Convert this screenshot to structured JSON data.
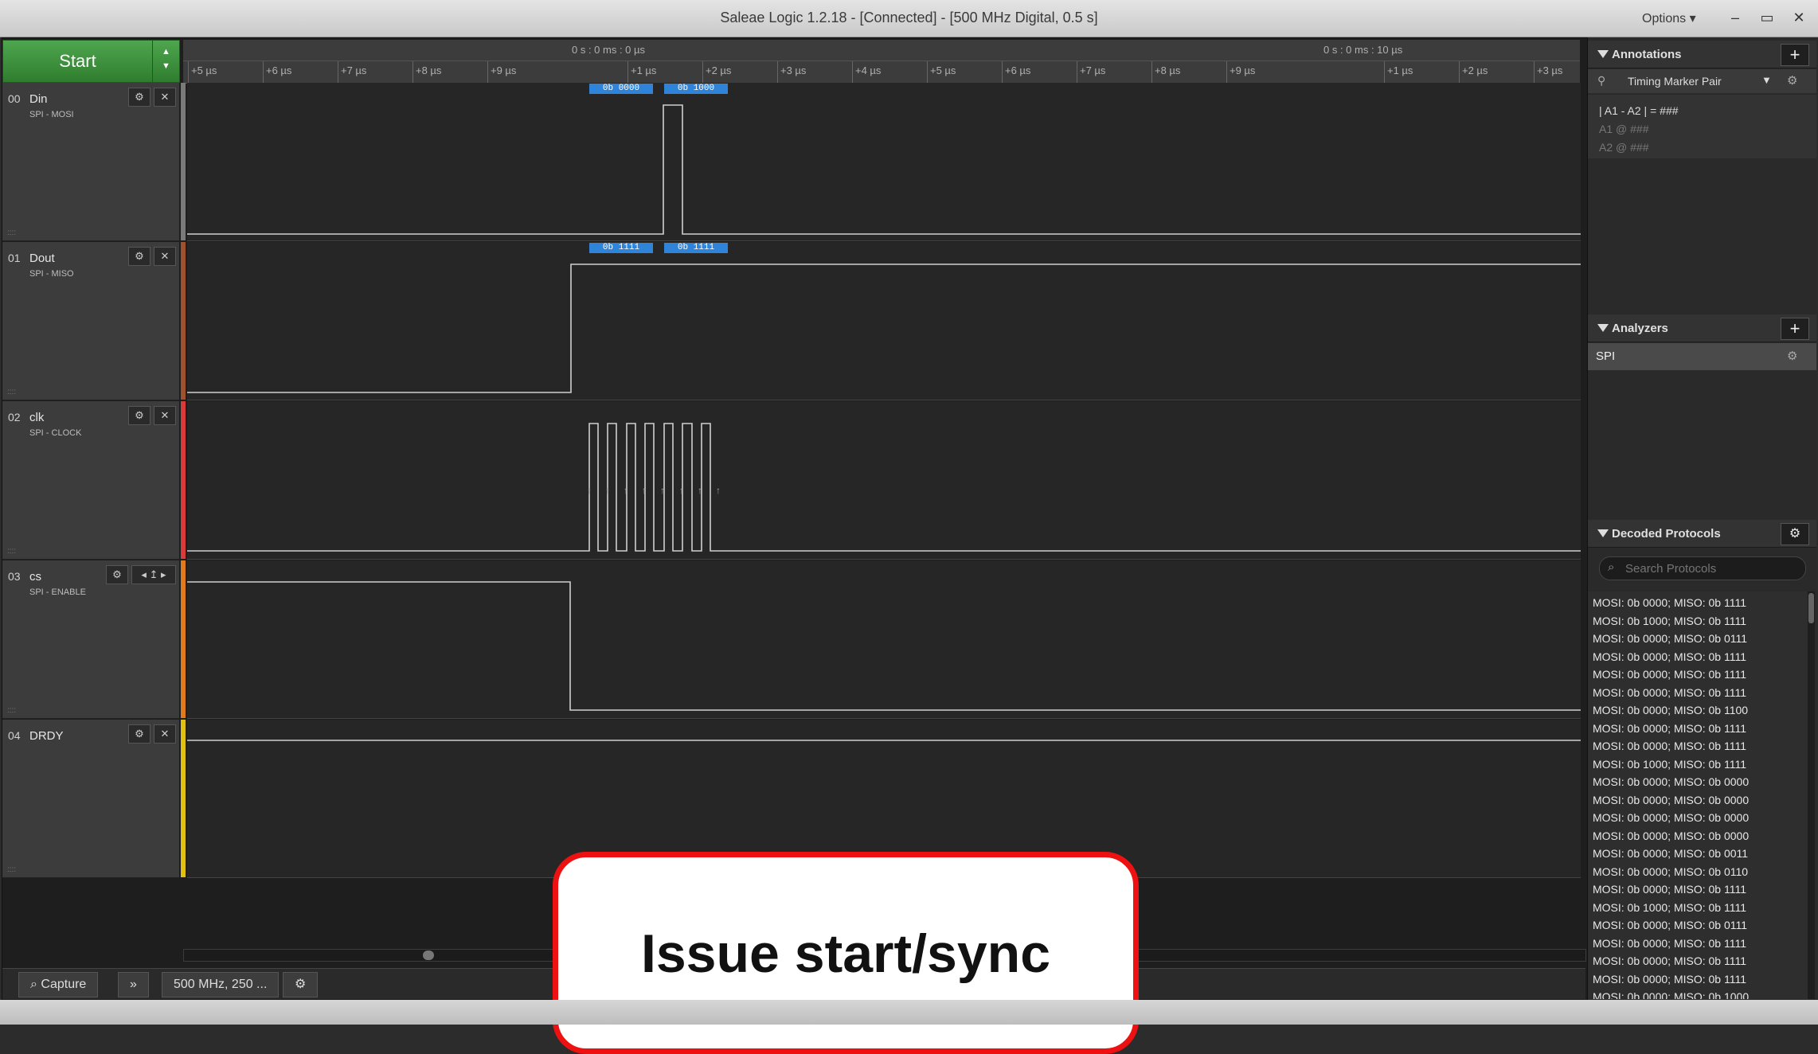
{
  "window": {
    "title": "Saleae Logic 1.2.18 - [Connected] - [500 MHz Digital, 0.5 s]",
    "options_label": "Options ▾",
    "minimize": "–",
    "restore": "▭",
    "close": "✕"
  },
  "toolbar": {
    "start_label": "Start",
    "sample_setting": "500 MHz, 250 ...",
    "capture_tab": "Capture",
    "expand": "»"
  },
  "ruler": {
    "top_left_time": "0 s : 0 ms : 0 µs",
    "top_right_time": "0 s : 0 ms : 10 µs",
    "ticks": [
      "+5 µs",
      "+6 µs",
      "+7 µs",
      "+8 µs",
      "+9 µs",
      "+1 µs",
      "+2 µs",
      "+3 µs",
      "+4 µs",
      "+5 µs",
      "+6 µs",
      "+7 µs",
      "+8 µs",
      "+9 µs",
      "+1 µs",
      "+2 µs",
      "+3 µs"
    ]
  },
  "channels": [
    {
      "num": "00",
      "name": "Din",
      "sub": "SPI - MOSI",
      "color": "#7a7a7a",
      "badges": [
        "0b 0000",
        "0b 1000"
      ]
    },
    {
      "num": "01",
      "name": "Dout",
      "sub": "SPI - MISO",
      "color": "#a0522d",
      "badges": [
        "0b 1111",
        "0b 1111"
      ]
    },
    {
      "num": "02",
      "name": "clk",
      "sub": "SPI - CLOCK",
      "color": "#d93a3a",
      "badges": []
    },
    {
      "num": "03",
      "name": "cs",
      "sub": "SPI - ENABLE",
      "color": "#e07a1a",
      "badges": []
    },
    {
      "num": "04",
      "name": "DRDY",
      "sub": "",
      "color": "#e0c010",
      "badges": []
    }
  ],
  "annotations": {
    "header": "Annotations",
    "add": "+",
    "marker_type": "Timing Marker Pair",
    "line1": "| A1 - A2 | = ###",
    "line2": "A1  @  ###",
    "line3": "A2  @  ###"
  },
  "analyzers": {
    "header": "Analyzers",
    "add": "+",
    "items": [
      "SPI"
    ]
  },
  "decoded": {
    "header": "Decoded Protocols",
    "search_placeholder": "Search Protocols",
    "rows": [
      "MOSI: 0b 0000;  MISO: 0b 1111",
      "MOSI: 0b 1000;  MISO: 0b 1111",
      "MOSI: 0b 0000;  MISO: 0b 0111",
      "MOSI: 0b 0000;  MISO: 0b 1111",
      "MOSI: 0b 0000;  MISO: 0b 1111",
      "MOSI: 0b 0000;  MISO: 0b 1111",
      "MOSI: 0b 0000;  MISO: 0b 1100",
      "MOSI: 0b 0000;  MISO: 0b 1111",
      "MOSI: 0b 0000;  MISO: 0b 1111",
      "MOSI: 0b 1000;  MISO: 0b 1111",
      "MOSI: 0b 0000;  MISO: 0b 0000",
      "MOSI: 0b 0000;  MISO: 0b 0000",
      "MOSI: 0b 0000;  MISO: 0b 0000",
      "MOSI: 0b 0000;  MISO: 0b 0000",
      "MOSI: 0b 0000;  MISO: 0b 0011",
      "MOSI: 0b 0000;  MISO: 0b 0110",
      "MOSI: 0b 0000;  MISO: 0b 1111",
      "MOSI: 0b 1000;  MISO: 0b 1111",
      "MOSI: 0b 0000;  MISO: 0b 0111",
      "MOSI: 0b 0000;  MISO: 0b 1111",
      "MOSI: 0b 0000;  MISO: 0b 1111",
      "MOSI: 0b 0000;  MISO: 0b 1111",
      "MOSI: 0b 0000;  MISO: 0b 1000"
    ]
  },
  "overlay": {
    "text": "Issue start/sync"
  }
}
